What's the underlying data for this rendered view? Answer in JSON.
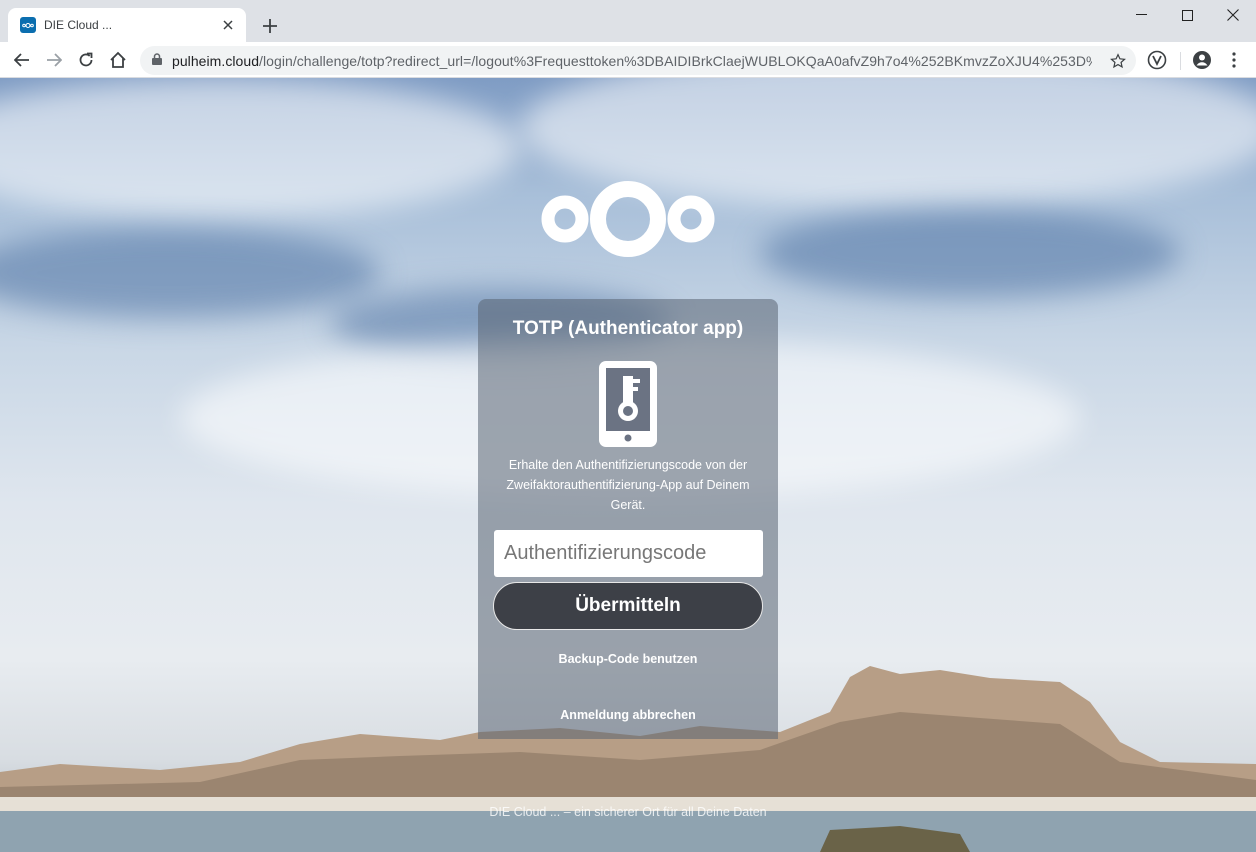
{
  "browser": {
    "tab_title": "DIE Cloud ...",
    "url_host": "pulheim.cloud",
    "url_path": "/login/challenge/totp?redirect_url=/logout%3Frequesttoken%3DBAIDIBrkClaejWUBLOKQaA0afvZ9h7o4%252BKmvzZoXJU4%253D%..."
  },
  "login": {
    "title": "TOTP (Authenticator app)",
    "description": "Erhalte den Authentifizierungscode von der Zweifaktorauthentifizierung-App auf Deinem Gerät.",
    "code_placeholder": "Authentifizierungscode",
    "code_value": "",
    "submit_label": "Übermitteln",
    "backup_link": "Backup-Code benutzen",
    "cancel_link": "Anmeldung abbrechen"
  },
  "footer": {
    "text": "DIE Cloud ... – ein sicherer Ort für all Deine Daten"
  },
  "colors": {
    "primary": "#0b6eaf",
    "button_bg": "#3d4047"
  }
}
